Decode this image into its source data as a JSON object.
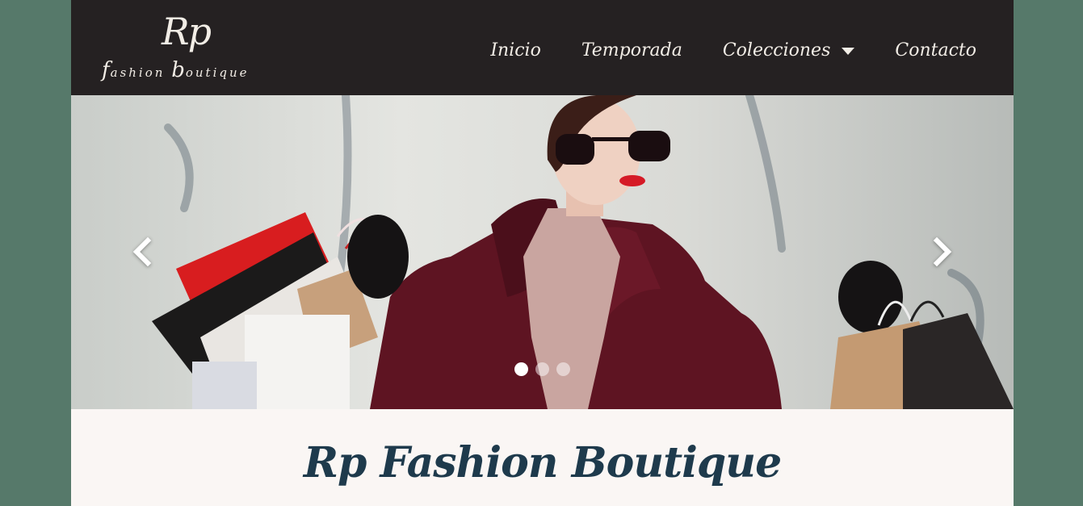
{
  "brand": {
    "logo_monogram": "Rp",
    "logo_word_1_initial": "f",
    "logo_word_1_rest": "ashion ",
    "logo_word_2_initial": "b",
    "logo_word_2_rest": "outique"
  },
  "nav": {
    "items": [
      {
        "label": "Inicio"
      },
      {
        "label": "Temporada"
      },
      {
        "label": "Colecciones",
        "has_dropdown": true
      },
      {
        "label": "Contacto"
      }
    ]
  },
  "carousel": {
    "slide_count": 3,
    "active_index": 0,
    "prev_icon": "chevron-left-icon",
    "next_icon": "chevron-right-icon"
  },
  "main": {
    "heading": "Rp Fashion Boutique"
  },
  "colors": {
    "page_background": "#56796a",
    "navbar": "#252122",
    "nav_text": "#f2ede6",
    "content_background": "#faf6f4",
    "heading": "#1e3a4c",
    "coat": "#5e1422"
  }
}
